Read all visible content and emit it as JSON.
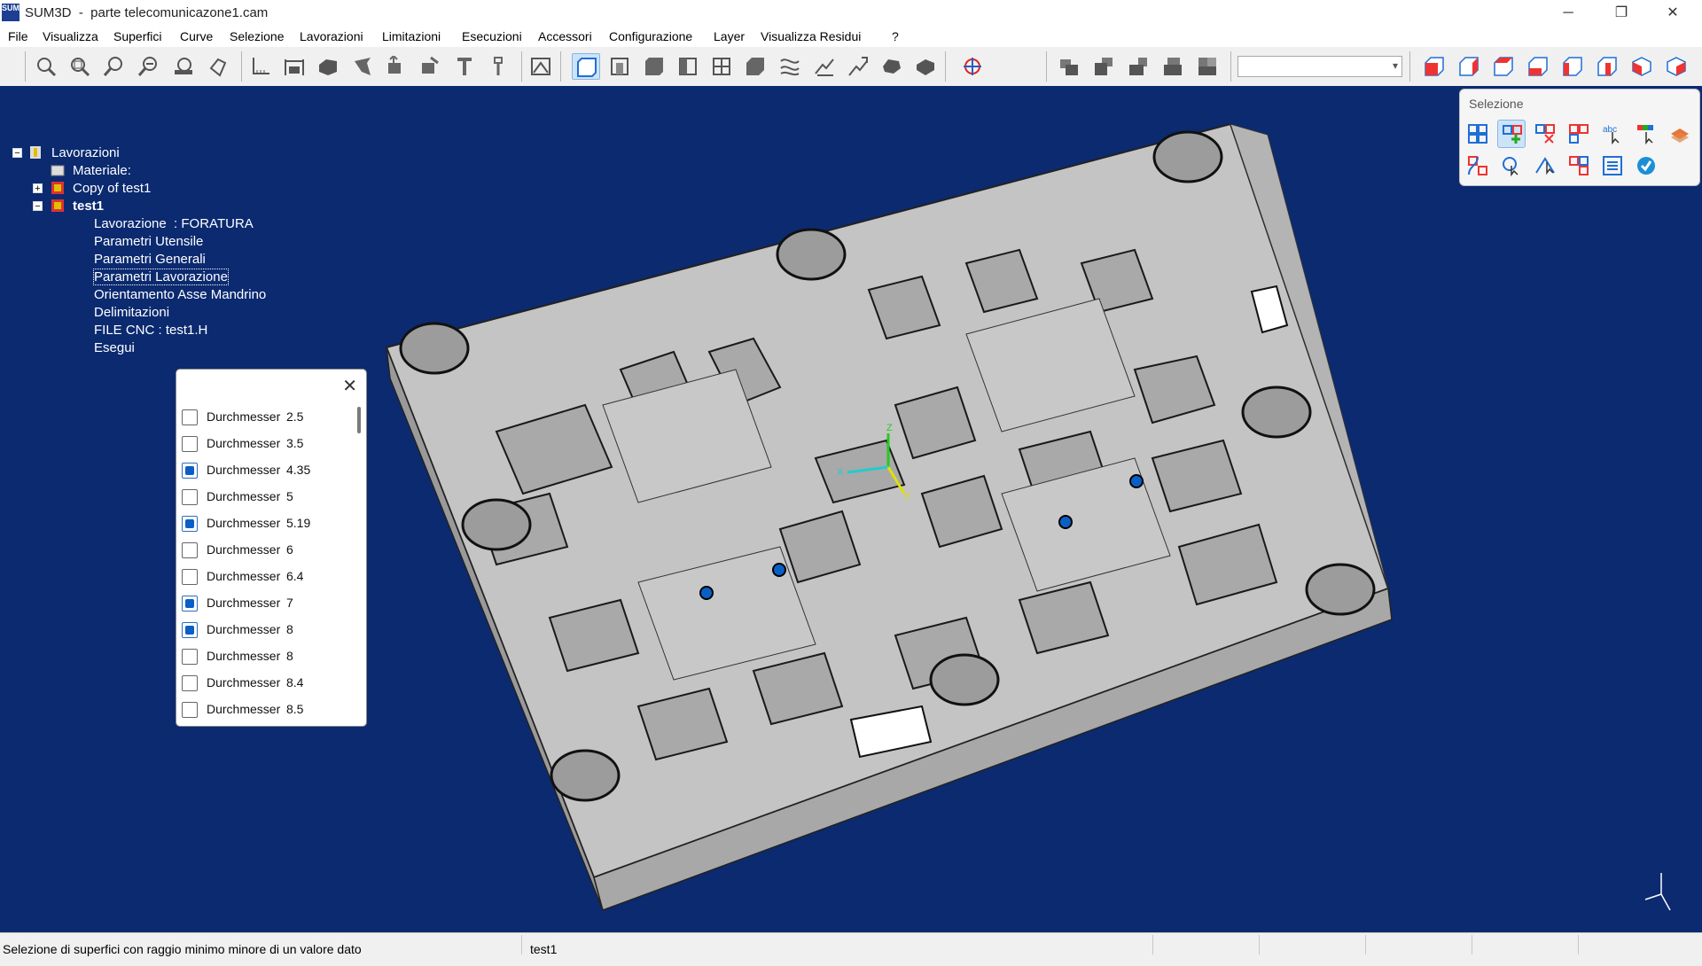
{
  "window": {
    "icon_text": "SUM",
    "title": "SUM3D  -  parte telecomunicazone1.cam",
    "controls": {
      "minimize": "─",
      "maximize": "❐",
      "close": "✕"
    }
  },
  "menu": [
    "File",
    "Visualizza",
    "Superfici",
    "Curve",
    "Selezione",
    "Lavorazioni",
    "Limitazioni",
    "Esecuzioni",
    "Accessori",
    "Configurazione",
    "Layer",
    "Visualizza Residui",
    "?"
  ],
  "toolbar": {
    "combo_value": "",
    "combo_arrow": "▾"
  },
  "tree": {
    "root": "Lavorazioni",
    "materiale": "Materiale:",
    "copy": "Copy of test1",
    "test1": "test1",
    "children": [
      "Lavorazione  : FORATURA",
      "Parametri Utensile",
      "Parametri Generali",
      "Parametri Lavorazione",
      "Orientamento Asse Mandrino",
      "Delimitazioni",
      "FILE CNC : test1.H",
      "Esegui"
    ],
    "expander_plus": "+",
    "expander_minus": "−"
  },
  "selezione_panel": {
    "title": "Selezione"
  },
  "diameter_panel": {
    "close": "✕",
    "rows": [
      {
        "label": "Durchmesser",
        "value": "2.5",
        "checked": false
      },
      {
        "label": "Durchmesser",
        "value": "3.5",
        "checked": false
      },
      {
        "label": "Durchmesser",
        "value": "4.35",
        "checked": true
      },
      {
        "label": "Durchmesser",
        "value": "5",
        "checked": false
      },
      {
        "label": "Durchmesser",
        "value": "5.19",
        "checked": true
      },
      {
        "label": "Durchmesser",
        "value": "6",
        "checked": false
      },
      {
        "label": "Durchmesser",
        "value": "6.4",
        "checked": false
      },
      {
        "label": "Durchmesser",
        "value": "7",
        "checked": true
      },
      {
        "label": "Durchmesser",
        "value": "8",
        "checked": true
      },
      {
        "label": "Durchmesser",
        "value": "8",
        "checked": false
      },
      {
        "label": "Durchmesser",
        "value": "8.4",
        "checked": false
      },
      {
        "label": "Durchmesser",
        "value": "8.5",
        "checked": false
      }
    ]
  },
  "triad": {
    "x": "X",
    "y": "Y",
    "z": "Z"
  },
  "status": {
    "text": "Selezione di superfici con raggio minimo minore di un valore dato",
    "document": "test1"
  },
  "colors": {
    "viewport": "#0b2a70",
    "part": "#bdbdbd",
    "accent": "#0a5fc7"
  }
}
